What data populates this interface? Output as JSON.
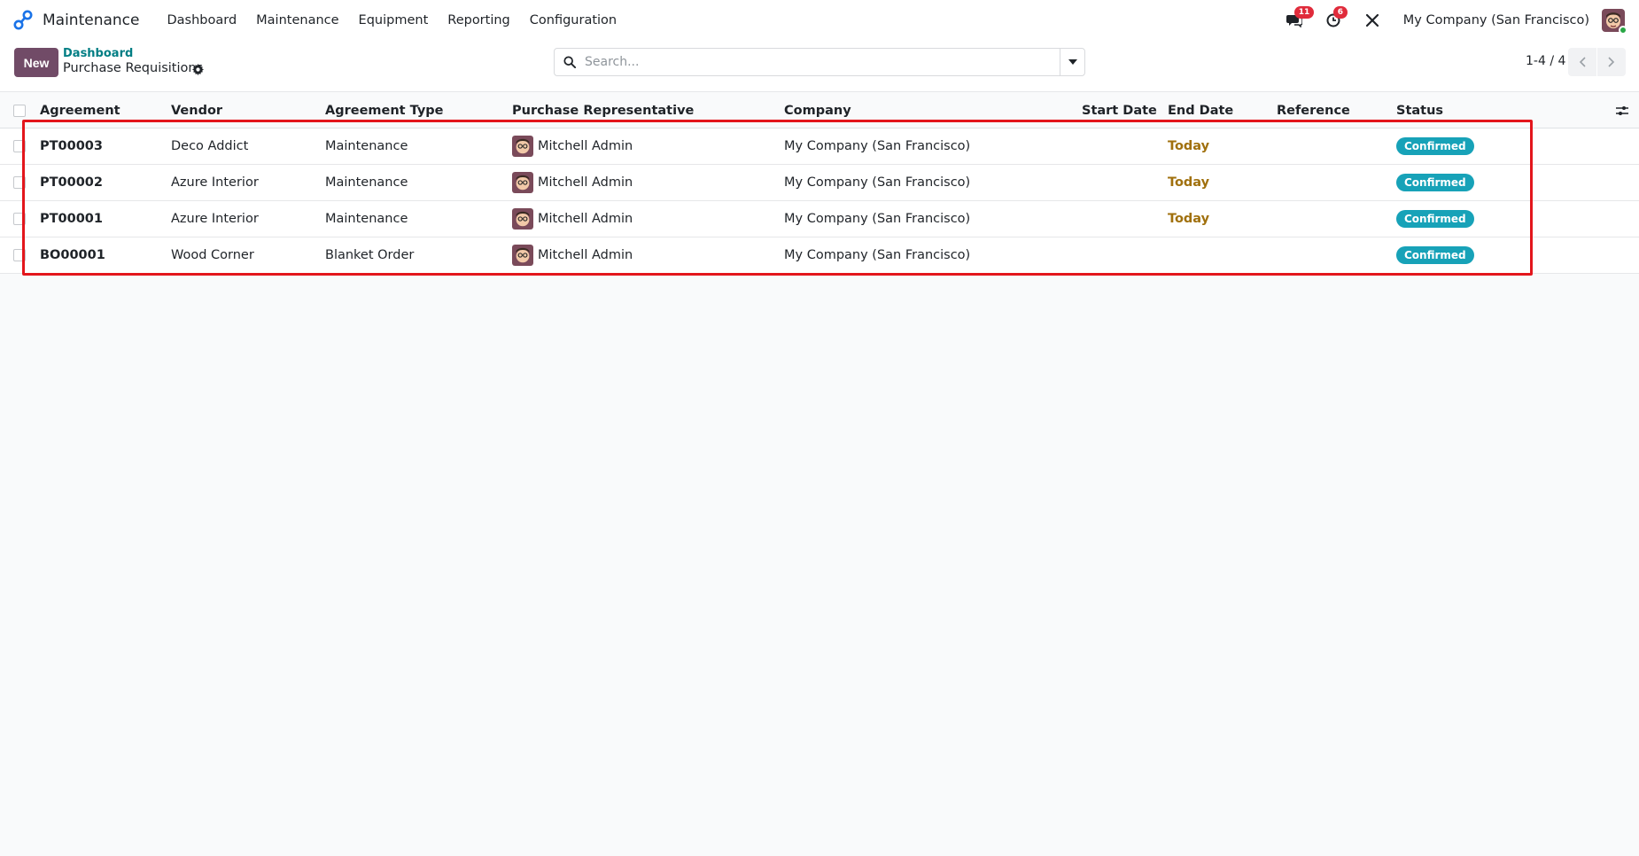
{
  "navbar": {
    "app_name": "Maintenance",
    "menu": [
      {
        "label": "Dashboard"
      },
      {
        "label": "Maintenance"
      },
      {
        "label": "Equipment"
      },
      {
        "label": "Reporting"
      },
      {
        "label": "Configuration"
      }
    ],
    "messages_count": "11",
    "activities_count": "6",
    "company": "My Company (San Francisco)"
  },
  "control": {
    "new_label": "New",
    "breadcrumb": "Dashboard",
    "title": "Purchase Requisitions",
    "search_placeholder": "Search...",
    "pager": "1-4 / 4"
  },
  "table": {
    "headers": {
      "agreement": "Agreement",
      "vendor": "Vendor",
      "agreement_type": "Agreement Type",
      "purchase_rep": "Purchase Representative",
      "company": "Company",
      "start_date": "Start Date",
      "end_date": "End Date",
      "reference": "Reference",
      "status": "Status"
    },
    "rows": [
      {
        "agreement": "PT00003",
        "vendor": "Deco Addict",
        "type": "Maintenance",
        "rep": "Mitchell Admin",
        "company": "My Company (San Francisco)",
        "start_date": "",
        "end_date": "Today",
        "reference": "",
        "status": "Confirmed"
      },
      {
        "agreement": "PT00002",
        "vendor": "Azure Interior",
        "type": "Maintenance",
        "rep": "Mitchell Admin",
        "company": "My Company (San Francisco)",
        "start_date": "",
        "end_date": "Today",
        "reference": "",
        "status": "Confirmed"
      },
      {
        "agreement": "PT00001",
        "vendor": "Azure Interior",
        "type": "Maintenance",
        "rep": "Mitchell Admin",
        "company": "My Company (San Francisco)",
        "start_date": "",
        "end_date": "Today",
        "reference": "",
        "status": "Confirmed"
      },
      {
        "agreement": "BO00001",
        "vendor": "Wood Corner",
        "type": "Blanket Order",
        "rep": "Mitchell Admin",
        "company": "My Company (San Francisco)",
        "start_date": "",
        "end_date": "",
        "reference": "",
        "status": "Confirmed"
      }
    ]
  },
  "colors": {
    "brand": "#714b67",
    "link": "#017e84",
    "status_confirmed": "#17a2b8",
    "today": "#a0700d",
    "highlight": "#e3161c"
  }
}
